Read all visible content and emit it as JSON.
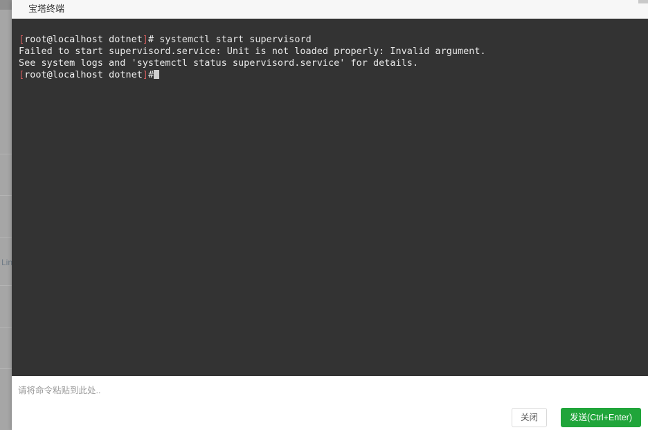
{
  "dialog": {
    "title": "宝塔终端"
  },
  "terminal": {
    "lines": [
      {
        "segments": [
          {
            "text": "[",
            "color": "red"
          },
          {
            "text": "root@localhost",
            "color": "white"
          },
          {
            "text": " dotnet",
            "color": "white"
          },
          {
            "text": "]",
            "color": "red"
          },
          {
            "text": "# ",
            "color": "white"
          },
          {
            "text": "systemctl start supervisord",
            "color": "plain"
          }
        ]
      },
      {
        "segments": [
          {
            "text": "Failed to start supervisord.service: Unit is not loaded properly: Invalid argument.",
            "color": "plain"
          }
        ]
      },
      {
        "segments": [
          {
            "text": "See system logs and 'systemctl status supervisord.service' for details.",
            "color": "plain"
          }
        ]
      },
      {
        "segments": [
          {
            "text": "[",
            "color": "red"
          },
          {
            "text": "root@localhost",
            "color": "white"
          },
          {
            "text": " dotnet",
            "color": "white"
          },
          {
            "text": "]",
            "color": "red"
          },
          {
            "text": "#",
            "color": "white"
          }
        ],
        "cursor": true
      }
    ]
  },
  "command_input": {
    "value": "",
    "placeholder": "请将命令粘贴到此处.."
  },
  "footer": {
    "close_label": "关闭",
    "send_label": "发送(Ctrl+Enter)"
  },
  "background_page": {
    "visible_text": "Lin"
  },
  "colors": {
    "accent_green": "#20a53a",
    "terminal_bg": "#333333",
    "header_bg": "#f7f7f7",
    "backdrop": "#a6a6a6"
  }
}
